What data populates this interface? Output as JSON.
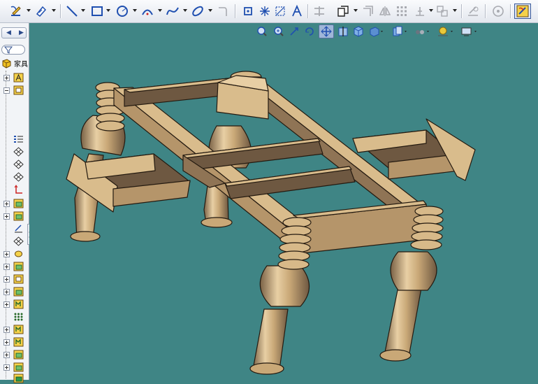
{
  "app": {
    "tree_root_label": "家具"
  },
  "toolbar": {
    "tools": [
      {
        "name": "sketch-icon"
      },
      {
        "name": "smart-dimension-icon"
      },
      {
        "name": "line-icon"
      },
      {
        "name": "rectangle-icon"
      },
      {
        "name": "circle-icon"
      },
      {
        "name": "arc-icon"
      },
      {
        "name": "spline-icon"
      },
      {
        "name": "ellipse-icon"
      },
      {
        "name": "fillet-icon"
      },
      {
        "name": "point-icon"
      },
      {
        "name": "centerline-icon"
      },
      {
        "name": "sketch-text-icon"
      },
      {
        "name": "trim-icon"
      },
      {
        "name": "convert-entities-icon"
      },
      {
        "name": "offset-icon"
      },
      {
        "name": "mirror-icon"
      },
      {
        "name": "linear-pattern-icon"
      },
      {
        "name": "move-entities-icon"
      },
      {
        "name": "display-relations-icon"
      },
      {
        "name": "repair-sketch-icon"
      },
      {
        "name": "quick-snaps-icon"
      }
    ]
  },
  "view_toolbar": {
    "buttons": [
      {
        "name": "zoom-to-fit-icon"
      },
      {
        "name": "zoom-to-area-icon"
      },
      {
        "name": "previous-view-icon"
      },
      {
        "name": "rotate-view-icon"
      },
      {
        "name": "pan-icon",
        "active": true
      },
      {
        "name": "section-view-icon"
      },
      {
        "name": "view-orientation-icon"
      },
      {
        "name": "display-style-icon"
      },
      {
        "name": "hide-show-items-icon"
      },
      {
        "name": "edit-appearance-icon"
      },
      {
        "name": "apply-scene-icon"
      },
      {
        "name": "view-settings-icon"
      }
    ]
  },
  "feature_tree": {
    "items": [
      {
        "name": "tree-root-part"
      },
      {
        "name": "tree-annotations"
      },
      {
        "name": "tree-material"
      },
      {
        "name": "tree-equations"
      },
      {
        "name": "tree-front-plane"
      },
      {
        "name": "tree-top-plane"
      },
      {
        "name": "tree-right-plane"
      },
      {
        "name": "tree-origin"
      },
      {
        "name": "tree-boss-extrude-1"
      },
      {
        "name": "tree-boss-extrude-2"
      },
      {
        "name": "tree-sketch"
      },
      {
        "name": "tree-plane"
      },
      {
        "name": "tree-revolve"
      },
      {
        "name": "tree-boss-extrude-3"
      },
      {
        "name": "tree-cut-extrude"
      },
      {
        "name": "tree-boss-extrude-4"
      },
      {
        "name": "tree-mirror-1"
      },
      {
        "name": "tree-pattern"
      },
      {
        "name": "tree-mirror-2"
      },
      {
        "name": "tree-mirror-3"
      },
      {
        "name": "tree-boss-extrude-5"
      },
      {
        "name": "tree-boss-extrude-6"
      },
      {
        "name": "tree-boss-extrude-7"
      }
    ]
  },
  "colors": {
    "viewport_background": "#3f8585",
    "wood_light": "#d9bc8c",
    "wood_mid": "#b5956a",
    "wood_dark": "#6e5841",
    "outline": "#241a10",
    "accent_blue": "#1f4fb0"
  }
}
